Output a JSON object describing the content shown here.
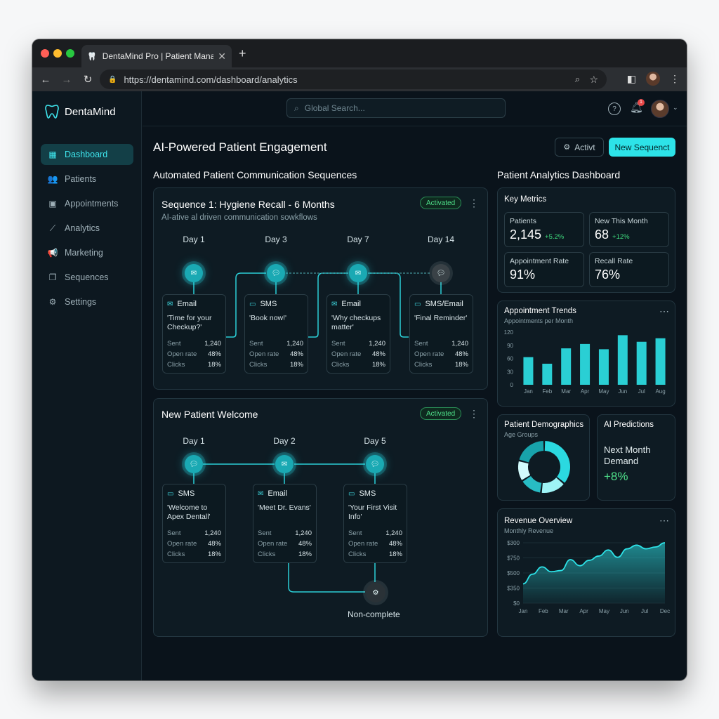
{
  "browser": {
    "tab_title": "DentaMind Pro | Patient Manag",
    "url": "https://dentamind.com/dashboard/analytics"
  },
  "sidebar": {
    "brand": "DentaMind",
    "items": [
      {
        "label": "Dashboard",
        "icon": "grid-icon",
        "active": true
      },
      {
        "label": "Patients",
        "icon": "users-icon"
      },
      {
        "label": "Appointments",
        "icon": "calendar-icon"
      },
      {
        "label": "Analytics",
        "icon": "trend-icon"
      },
      {
        "label": "Marketing",
        "icon": "megaphone-icon"
      },
      {
        "label": "Sequences",
        "icon": "copy-icon"
      },
      {
        "label": "Settings",
        "icon": "gear-icon"
      }
    ]
  },
  "topbar": {
    "search_placeholder": "Global Search...",
    "notif_count": "1"
  },
  "header": {
    "title": "AI-Powered Patient Engagement",
    "btn_secondary": "Activt",
    "btn_primary": "New Sequenct"
  },
  "sequences": {
    "section_title": "Automated Patient Communication Sequences",
    "seq1": {
      "title": "Sequence 1: Hygiene Recall - 6 Months",
      "subtitle": "AI-ative al driven communication sowkflows",
      "badge": "Activated",
      "steps": [
        {
          "day": "Day 1",
          "channel": "Email",
          "message": "'Time for your Checkup?'",
          "sent": "1,240",
          "open_rate": "48%",
          "clicks": "18%"
        },
        {
          "day": "Day 3",
          "channel": "SMS",
          "message": "'Book now!'",
          "sent": "1,240",
          "open_rate": "48%",
          "clicks": "18%"
        },
        {
          "day": "Day 7",
          "channel": "Email",
          "message": "'Why checkups matter'",
          "sent": "1,240",
          "open_rate": "48%",
          "clicks": "18%"
        },
        {
          "day": "Day 14",
          "channel": "SMS/Email",
          "message": "'Final Reminder'",
          "sent": "1,240",
          "open_rate": "48%",
          "clicks": "18%"
        }
      ]
    },
    "seq2": {
      "title": "New Patient Welcome",
      "badge": "Activated",
      "steps": [
        {
          "day": "Day 1",
          "channel": "SMS",
          "message": "'Welcome to Apex Dentall'",
          "sent": "1,240",
          "open_rate": "48%",
          "clicks": "18%"
        },
        {
          "day": "Day 2",
          "channel": "Email",
          "message": "'Meet Dr. Evans'",
          "sent": "1,240",
          "open_rate": "48%",
          "clicks": "18%"
        },
        {
          "day": "Day 5",
          "channel": "SMS",
          "message": "'Your First Visit Info'",
          "sent": "1,240",
          "open_rate": "48%",
          "clicks": "18%"
        }
      ],
      "end_label": "Non-complete"
    },
    "stat_labels": {
      "sent": "Sent",
      "open_rate": "Open rate",
      "clicks": "Clicks"
    }
  },
  "analytics": {
    "section_title": "Patient Analytics Dashboard",
    "key_metrics": {
      "title": "Key Metrics",
      "items": [
        {
          "label": "Patients",
          "value": "2,145",
          "delta": "+5.2%"
        },
        {
          "label": "New This Month",
          "value": "68",
          "delta": "+12%"
        },
        {
          "label": "Appointment Rate",
          "value": "91%",
          "delta": ""
        },
        {
          "label": "Recall Rate",
          "value": "76%",
          "delta": ""
        }
      ]
    },
    "trends": {
      "title": "Appointment Trends",
      "subtitle": "Appointments per Month"
    },
    "demographics": {
      "title": "Patient Demographics",
      "subtitle": "Age Groups"
    },
    "predictions": {
      "title": "AI Predictions",
      "label": "Next Month Demand",
      "value": "+8%"
    },
    "revenue": {
      "title": "Revenue Overview",
      "subtitle": "Monthly Revenue"
    }
  },
  "chart_data": [
    {
      "type": "bar",
      "title": "Appointment Trends",
      "categories": [
        "Jan",
        "Feb",
        "Mar",
        "Apr",
        "May",
        "Jun",
        "Jul",
        "Aug"
      ],
      "values": [
        63,
        48,
        83,
        93,
        81,
        113,
        98,
        106
      ],
      "yticks": [
        "120",
        "90",
        "60",
        "30",
        "0"
      ],
      "ylim": [
        0,
        120
      ],
      "color": "#2de3e8"
    },
    {
      "type": "pie",
      "title": "Patient Demographics",
      "values": [
        36,
        16,
        14,
        13,
        21
      ],
      "colors": [
        "#2bd9e0",
        "#9ef4f6",
        "#28bcc4",
        "#d2fbfc",
        "#18a3ab"
      ]
    },
    {
      "type": "area",
      "title": "Revenue Overview",
      "categories": [
        "Jan",
        "Feb",
        "Mar",
        "Apr",
        "May",
        "Jun",
        "Jul",
        "Dec"
      ],
      "yticks": [
        "$300",
        "$750",
        "$500",
        "$350",
        "$0"
      ],
      "values": [
        0.32,
        0.48,
        0.6,
        0.52,
        0.54,
        0.72,
        0.62,
        0.71,
        0.78,
        0.88,
        0.76,
        0.9,
        0.96,
        0.9,
        0.93,
        1.0
      ],
      "color": "#2de3e8"
    }
  ],
  "colors": {
    "accent": "#2de3e8",
    "positive": "#4fe08a",
    "bg": "#0a131b"
  }
}
